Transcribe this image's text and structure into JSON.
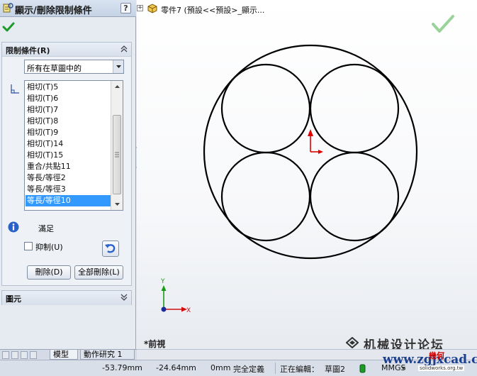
{
  "property_manager": {
    "title": "顯示/刪除限制條件",
    "help_label": "?",
    "ok_icon": "green-check-icon",
    "constraints_group": {
      "title": "限制條件(R)",
      "filter": {
        "selected": "所有在草圖中的"
      },
      "relations": [
        "相切(T)5",
        "相切(T)6",
        "相切(T)7",
        "相切(T)8",
        "相切(T)9",
        "相切(T)14",
        "相切(T)15",
        "重合/共點11",
        "等長/等徑2",
        "等長/等徑3",
        "等長/等徑10"
      ],
      "selected_index": 10,
      "status_text": "滿足",
      "suppress_label": "抑制(U)",
      "delete_label": "刪除(D)",
      "delete_all_label": "全部刪除(L)"
    },
    "entities_group": {
      "title": "圖元"
    }
  },
  "graphics": {
    "tree_label": "零件7 (預設<<預設>_顯示...",
    "view_name": "*前視",
    "triad": {
      "x_label": "X",
      "y_label": "Y"
    },
    "colors": {
      "origin": "#e00000",
      "sketch": "#000000",
      "confirm": "#7ccf7c"
    }
  },
  "tabs": {
    "model": "模型",
    "motion_study": "動作研究 1"
  },
  "status_bar": {
    "x_coord": "-53.79mm",
    "y_coord": "-24.64mm",
    "z_coord": "0mm",
    "definition_state": "完全定義",
    "editing_label": "正在編輯：",
    "editing_target": "草圖2",
    "units": "MMGS"
  },
  "watermark": {
    "text": "机械设计论坛",
    "url": "www.zgjxcad.com",
    "brand": "幾何",
    "site": "solidworks.org.tw"
  }
}
